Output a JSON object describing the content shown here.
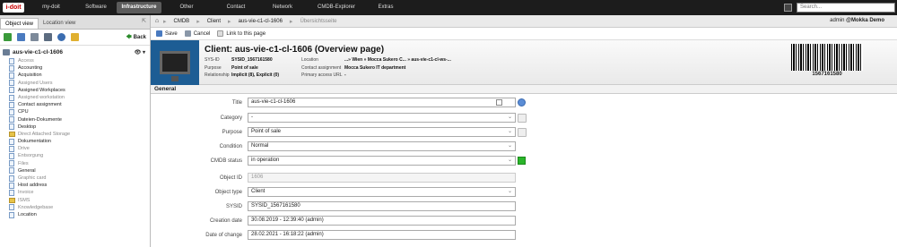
{
  "app": {
    "logo": "i-doit"
  },
  "nav": {
    "items": [
      "my-doit",
      "Software",
      "Infrastructure",
      "Other",
      "Contact",
      "Network",
      "CMDB-Explorer",
      "Extras"
    ],
    "active_index": 2
  },
  "search": {
    "placeholder": "Search..."
  },
  "sidebar": {
    "tabs": [
      "Object view",
      "Location view"
    ],
    "active_tab": 0,
    "back_label": "Back",
    "root_label": "aus-vie-c1-cl-1606",
    "items": [
      {
        "label": "Access",
        "dim": true,
        "icon": "doc"
      },
      {
        "label": "Accounting",
        "dim": false,
        "icon": "doc"
      },
      {
        "label": "Acquisition",
        "dim": false,
        "icon": "doc"
      },
      {
        "label": "Assigned Users",
        "dim": true,
        "icon": "doc"
      },
      {
        "label": "Assigned Workplaces",
        "dim": false,
        "icon": "doc"
      },
      {
        "label": "Assigned workstation",
        "dim": true,
        "icon": "doc"
      },
      {
        "label": "Contact assignment",
        "dim": false,
        "icon": "doc"
      },
      {
        "label": "CPU",
        "dim": false,
        "icon": "doc"
      },
      {
        "label": "Dateien-Dokumente",
        "dim": false,
        "icon": "doc"
      },
      {
        "label": "Desktop",
        "dim": false,
        "icon": "doc"
      },
      {
        "label": "Direct Attached Storage",
        "dim": true,
        "icon": "folder"
      },
      {
        "label": "Dokumentation",
        "dim": false,
        "icon": "doc"
      },
      {
        "label": "Drive",
        "dim": true,
        "icon": "doc"
      },
      {
        "label": "Entsorgung",
        "dim": true,
        "icon": "doc"
      },
      {
        "label": "Files",
        "dim": true,
        "icon": "doc"
      },
      {
        "label": "General",
        "dim": false,
        "icon": "doc"
      },
      {
        "label": "Graphic card",
        "dim": true,
        "icon": "doc"
      },
      {
        "label": "Host address",
        "dim": false,
        "icon": "doc"
      },
      {
        "label": "Invoice",
        "dim": true,
        "icon": "doc"
      },
      {
        "label": "ISMS",
        "dim": true,
        "icon": "folder"
      },
      {
        "label": "Knowledgebase",
        "dim": true,
        "icon": "doc"
      },
      {
        "label": "Location",
        "dim": false,
        "icon": "doc"
      }
    ]
  },
  "breadcrumb": {
    "items": [
      "CMDB",
      "Client",
      "aus-vie-c1-cl-1606",
      "Übersichtsseite"
    ]
  },
  "user": {
    "name": "admin",
    "tenant": "@Mokka Demo"
  },
  "actions": {
    "save": "Save",
    "cancel": "Cancel",
    "link": "Link to this page"
  },
  "header": {
    "title": "Client: aus-vie-c1-cl-1606 (Overview page)",
    "sysid_label": "SYS-ID",
    "sysid_value": "SYSID_1567161580",
    "purpose_label": "Purpose",
    "purpose_value": "Point of sale",
    "relationship_label": "Relationship",
    "relationship_value": "Implicit (8), Explicit (0)",
    "location_label": "Location",
    "location_value": "...» Wien » Mocca Sukero C... » aus-vie-c1-cl-ws-...",
    "contact_label": "Contact assignment",
    "contact_value": "Mocca Sukero IT department",
    "access_label": "Primary access URL",
    "access_value": "-",
    "barcode_text": "1567161580"
  },
  "section": {
    "title": "General"
  },
  "form": {
    "title_label": "Title",
    "title_value": "aus-vie-c1-cl-1606",
    "category_label": "Category",
    "category_value": "-",
    "purpose_label": "Purpose",
    "purpose_value": "Point of sale",
    "condition_label": "Condition",
    "condition_value": "Normal",
    "cmdb_label": "CMDB status",
    "cmdb_value": "in operation",
    "objid_label": "Object ID",
    "objid_value": "1606",
    "objtype_label": "Object type",
    "objtype_value": "Client",
    "sysid_label": "SYSID",
    "sysid_value": "SYSID_1567161580",
    "created_label": "Creation date",
    "created_value": "30.08.2019 - 12:39:40 (admin)",
    "changed_label": "Date of change",
    "changed_value": "28.02.2021 - 16:18:22 (admin)"
  },
  "colors": {
    "accent": "#2bb52b",
    "header_bg": "#1c1c1c",
    "image_bg": "#1d5d94"
  }
}
